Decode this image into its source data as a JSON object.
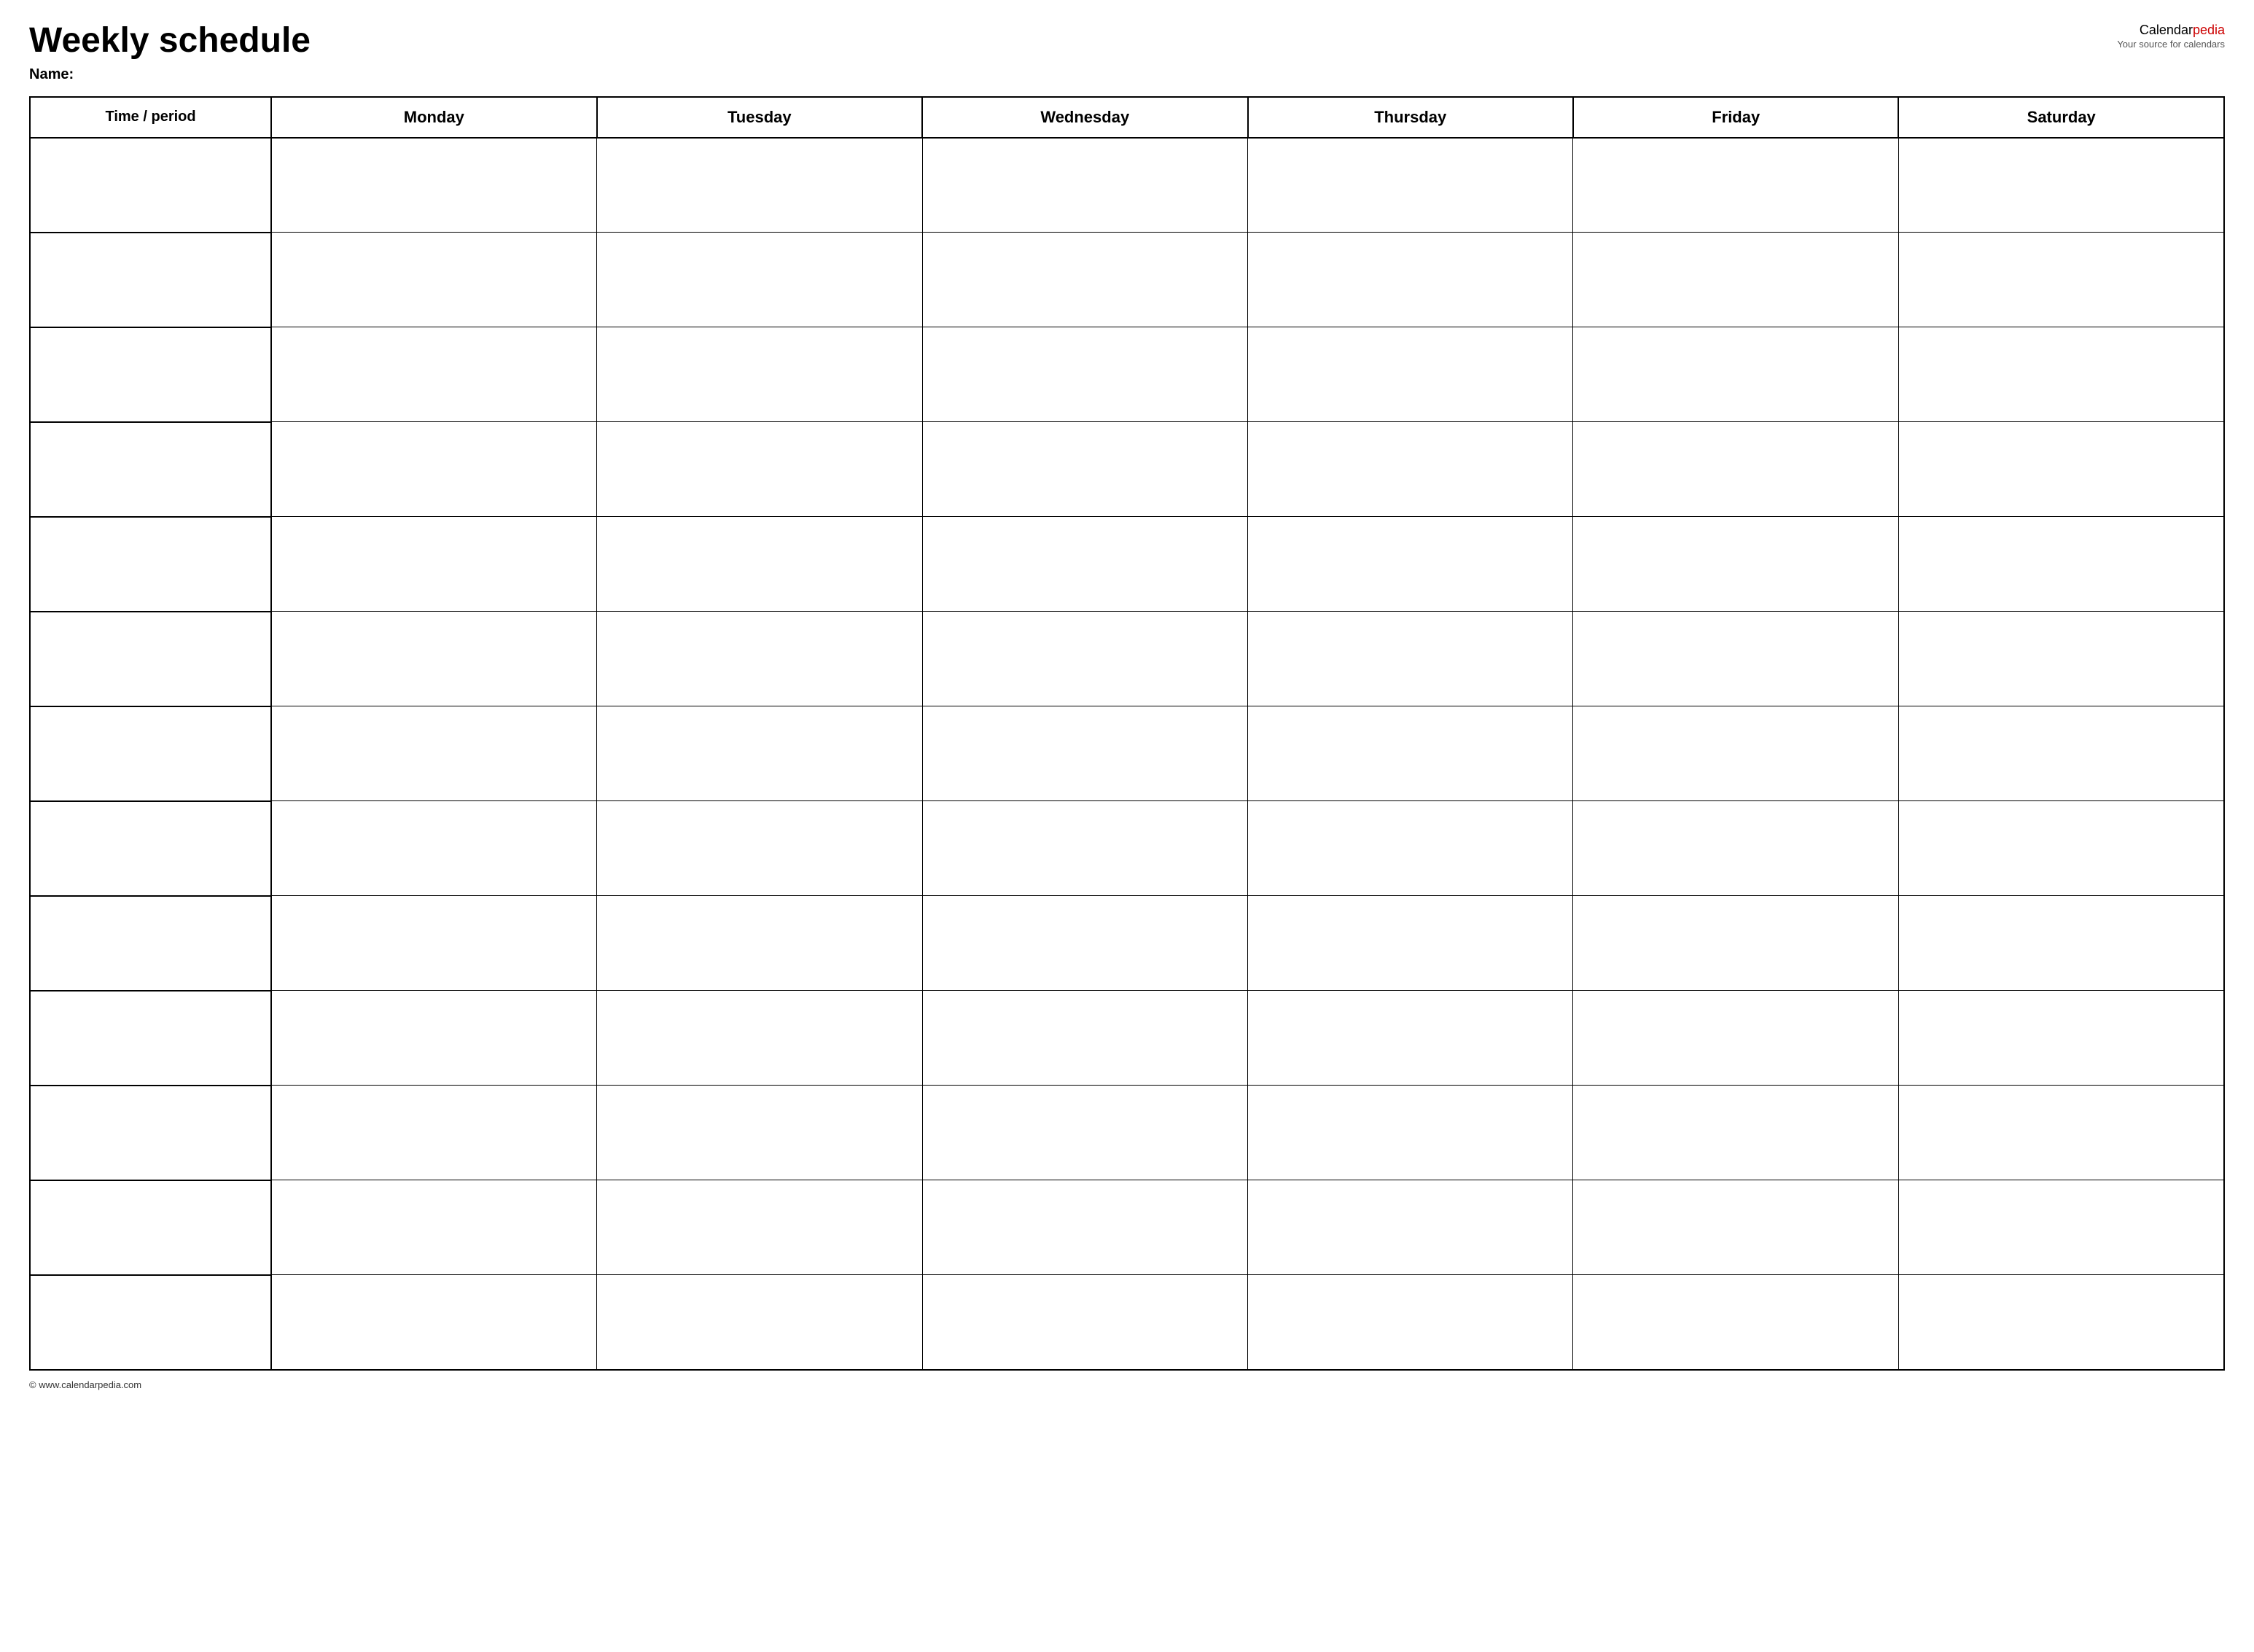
{
  "header": {
    "title": "Weekly schedule",
    "name_label": "Name:",
    "logo_text_black": "Calendar",
    "logo_text_red": "pedia",
    "logo_tagline": "Your source for calendars"
  },
  "table": {
    "columns": [
      {
        "key": "time",
        "label": "Time / period"
      },
      {
        "key": "monday",
        "label": "Monday"
      },
      {
        "key": "tuesday",
        "label": "Tuesday"
      },
      {
        "key": "wednesday",
        "label": "Wednesday"
      },
      {
        "key": "thursday",
        "label": "Thursday"
      },
      {
        "key": "friday",
        "label": "Friday"
      },
      {
        "key": "saturday",
        "label": "Saturday"
      }
    ],
    "row_count": 13
  },
  "footer": {
    "text": "© www.calendarpedia.com"
  }
}
